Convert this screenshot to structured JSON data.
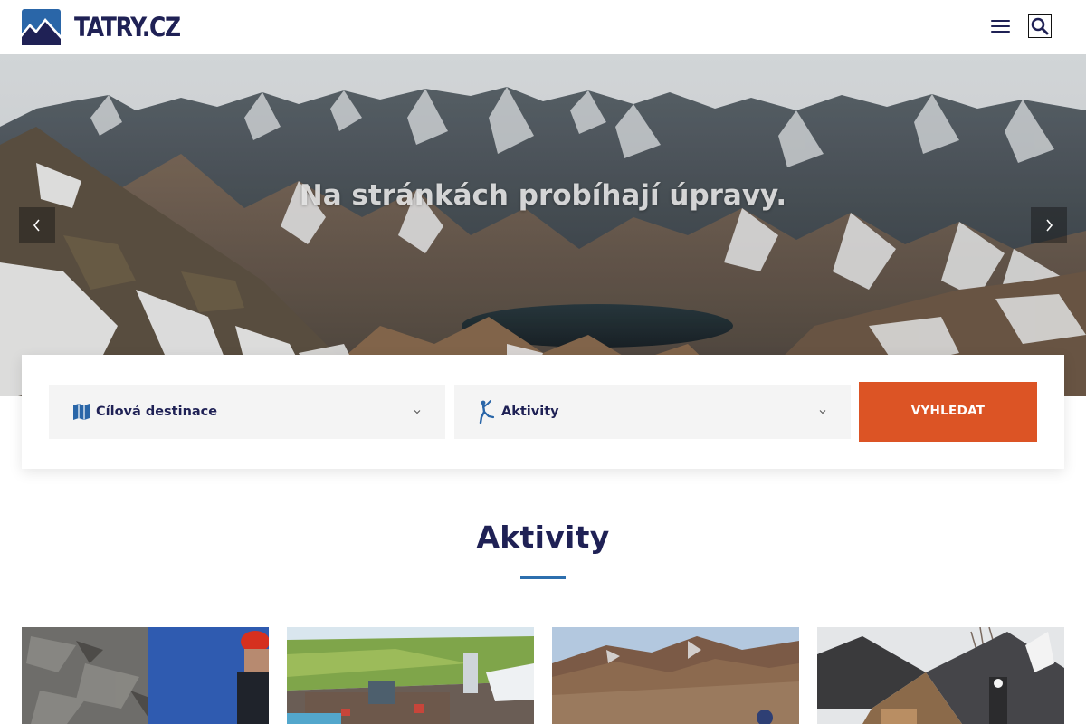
{
  "header": {
    "logo_text": "TATRY.CZ",
    "menu_icon": "hamburger-menu-icon",
    "search_icon": "search-icon"
  },
  "hero": {
    "title": "Na stránkách probíhají úpravy.",
    "prev_icon": "chevron-left-icon",
    "next_icon": "chevron-right-icon"
  },
  "search": {
    "destination_label": "Cílová destinace",
    "destination_icon": "map-icon",
    "activities_label": "Aktivity",
    "activities_icon": "climber-icon",
    "submit_label": "VYHLEDAT"
  },
  "activities": {
    "title": "Aktivity",
    "cards": [
      {
        "image": "climber-rock-photo"
      },
      {
        "image": "aquapark-resort-photo"
      },
      {
        "image": "mountain-ridge-hiker-photo"
      },
      {
        "image": "wooden-chalet-photo"
      }
    ]
  },
  "colors": {
    "brand_navy": "#1f2155",
    "accent_orange": "#dc5425",
    "accent_blue": "#2d6fae"
  }
}
